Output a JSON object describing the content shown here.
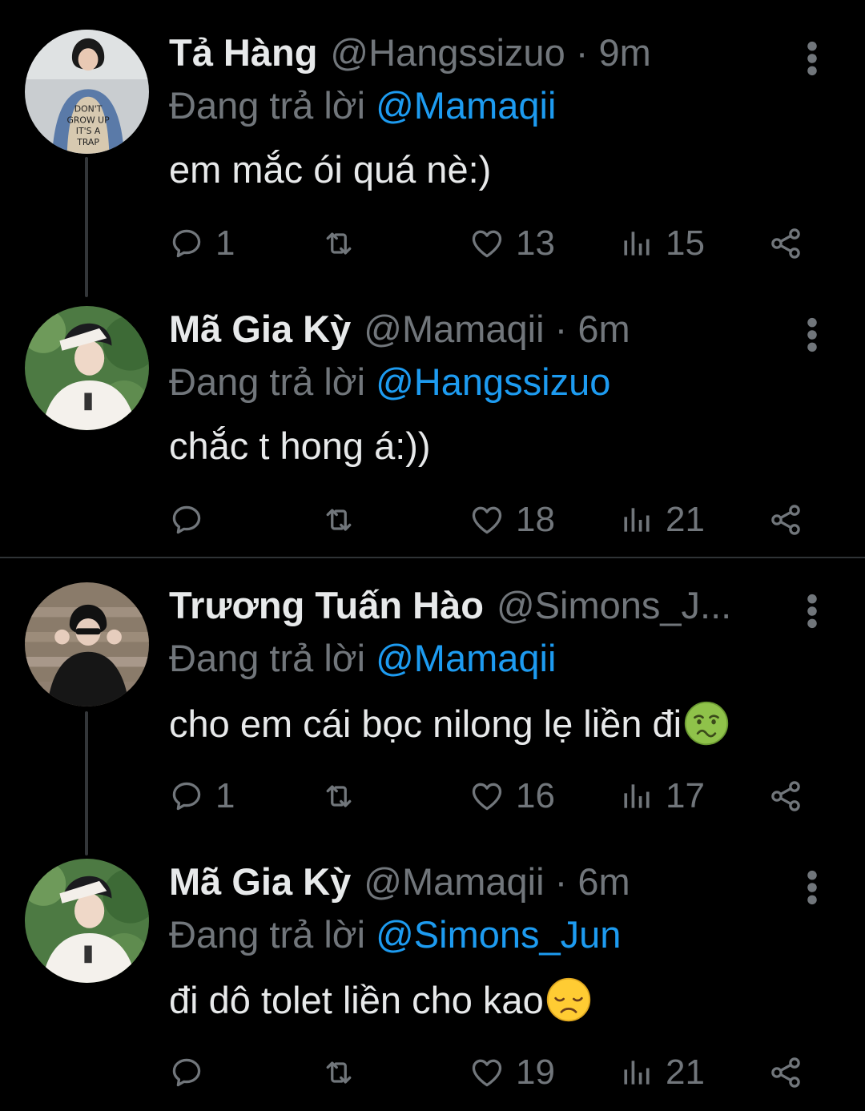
{
  "replying_prefix": "Đang trả lời",
  "colors": {
    "background": "#000000",
    "text": "#e7e9ea",
    "muted": "#71767b",
    "accent": "#1d9bf0",
    "thread_line": "#333639"
  },
  "tweets": [
    {
      "name": "Tả Hàng",
      "handle": "@Hangssizuo",
      "time": "9m",
      "meta": "@Hangssizuo · 9m",
      "replying_to": "@Mamaqii",
      "text": "em mắc ói quá nè:)",
      "emoji": "",
      "replies": "1",
      "retweets": "",
      "likes": "13",
      "views": "15",
      "avatar_icon": "avatar-denim-vest"
    },
    {
      "name": "Mã Gia Kỳ",
      "handle": "@Mamaqii",
      "time": "6m",
      "meta": "@Mamaqii · 6m",
      "replying_to": "@Hangssizuo",
      "text": "chắc t hong á:))",
      "emoji": "",
      "replies": "",
      "retweets": "",
      "likes": "18",
      "views": "21",
      "avatar_icon": "avatar-white-sweater"
    },
    {
      "name": "Trương Tuấn Hào",
      "handle": "@Simons_J...",
      "time": "",
      "meta": "@Simons_J...",
      "replying_to": "@Mamaqii",
      "text": "cho em cái bọc nilong lẹ liền đi",
      "emoji": "nauseated-face",
      "replies": "1",
      "retweets": "",
      "likes": "16",
      "views": "17",
      "avatar_icon": "avatar-dark-stairs"
    },
    {
      "name": "Mã Gia Kỳ",
      "handle": "@Mamaqii",
      "time": "6m",
      "meta": "@Mamaqii · 6m",
      "replying_to": "@Simons_Jun",
      "text": "đi dô tolet liền cho kao",
      "emoji": "disappointed-face",
      "replies": "",
      "retweets": "",
      "likes": "19",
      "views": "21",
      "avatar_icon": "avatar-white-sweater"
    }
  ]
}
